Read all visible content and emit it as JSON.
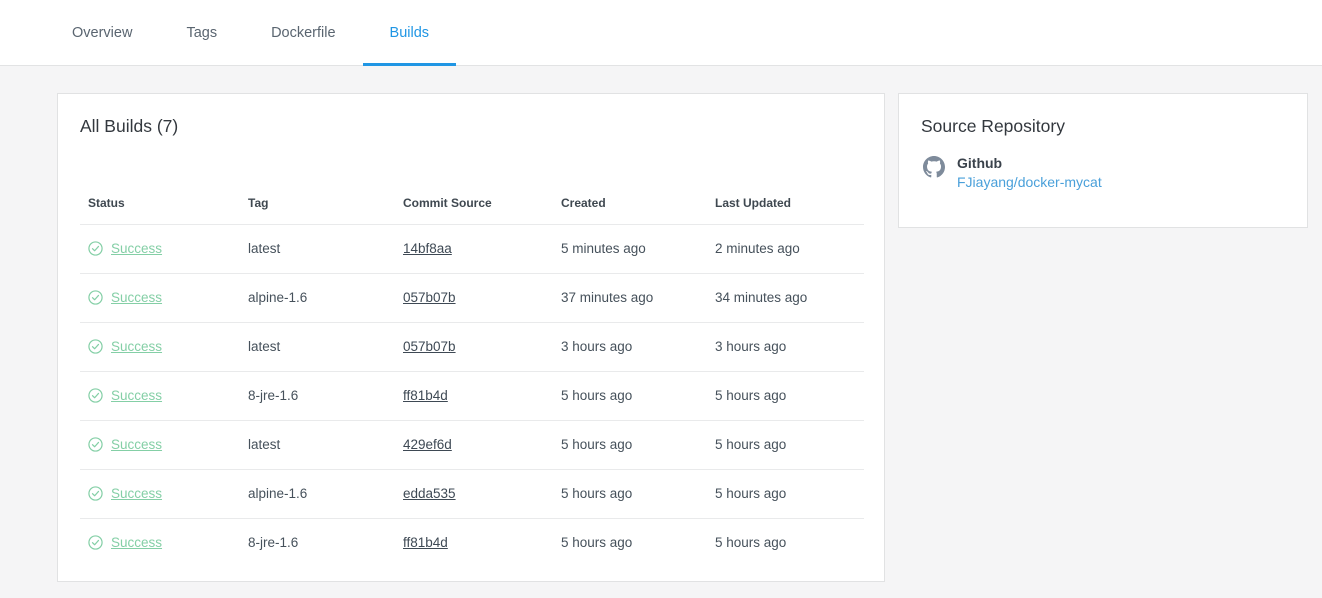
{
  "nav": {
    "tabs": [
      {
        "label": "Overview",
        "active": false
      },
      {
        "label": "Tags",
        "active": false
      },
      {
        "label": "Dockerfile",
        "active": false
      },
      {
        "label": "Builds",
        "active": true
      }
    ]
  },
  "builds_panel": {
    "title": "All Builds (7)",
    "columns": [
      "Status",
      "Tag",
      "Commit Source",
      "Created",
      "Last Updated"
    ],
    "rows": [
      {
        "status": "Success",
        "tag": "latest",
        "commit": "14bf8aa",
        "created": "5 minutes ago",
        "updated": "2 minutes ago"
      },
      {
        "status": "Success",
        "tag": "alpine-1.6",
        "commit": "057b07b",
        "created": "37 minutes ago",
        "updated": "34 minutes ago"
      },
      {
        "status": "Success",
        "tag": "latest",
        "commit": "057b07b",
        "created": "3 hours ago",
        "updated": "3 hours ago"
      },
      {
        "status": "Success",
        "tag": "8-jre-1.6",
        "commit": "ff81b4d",
        "created": "5 hours ago",
        "updated": "5 hours ago"
      },
      {
        "status": "Success",
        "tag": "latest",
        "commit": "429ef6d",
        "created": "5 hours ago",
        "updated": "5 hours ago"
      },
      {
        "status": "Success",
        "tag": "alpine-1.6",
        "commit": "edda535",
        "created": "5 hours ago",
        "updated": "5 hours ago"
      },
      {
        "status": "Success",
        "tag": "8-jre-1.6",
        "commit": "ff81b4d",
        "created": "5 hours ago",
        "updated": "5 hours ago"
      }
    ]
  },
  "source_panel": {
    "title": "Source Repository",
    "provider": "Github",
    "repo": "FJiayang/docker-mycat",
    "icon": "github-icon"
  },
  "colors": {
    "accent_blue": "#2096e4",
    "success_green": "#84cfa6",
    "link_blue": "#4aa0da",
    "github_gray": "#7e8b9b"
  }
}
